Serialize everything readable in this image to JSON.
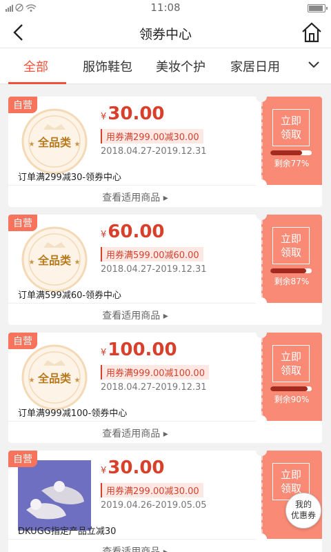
{
  "status": {
    "time": "11:08"
  },
  "nav": {
    "title": "领券中心"
  },
  "tabs": [
    "全部",
    "服饰鞋包",
    "美妆个护",
    "家居日用"
  ],
  "see_goods": "查看适用商品 ▸",
  "self_tag": "自营",
  "claim_lines": [
    "立即",
    "领取"
  ],
  "all_category_badge": "全品类",
  "coupons": [
    {
      "amount": "30.00",
      "condition": "用券满299.00减30.00",
      "date": "2018.04.27-2019.12.31",
      "desc": "订单满299减30-领券中心",
      "remain": "剩余77%",
      "remain_pct": 77
    },
    {
      "amount": "60.00",
      "condition": "用券满599.00减60.00",
      "date": "2018.04.27-2019.12.31",
      "desc": "订单满599减60-领券中心",
      "remain": "剩余87%",
      "remain_pct": 87
    },
    {
      "amount": "100.00",
      "condition": "用券满999.00减100.00",
      "date": "2018.04.27-2019.12.31",
      "desc": "订单满999减100-领券中心",
      "remain": "剩余90%",
      "remain_pct": 90
    },
    {
      "amount": "30.00",
      "condition": "用券满299.00减30.00",
      "date": "2019.04.26-2019.05.05",
      "desc": "DKUGG指定产品立减30",
      "remain": "",
      "remain_pct": null
    }
  ],
  "currency": "¥",
  "float_button": {
    "line1": "我的",
    "line2": "优惠券"
  },
  "colors": {
    "accent": "#f0503a",
    "coupon_bg": "#f98a75",
    "price": "#d8402c"
  }
}
